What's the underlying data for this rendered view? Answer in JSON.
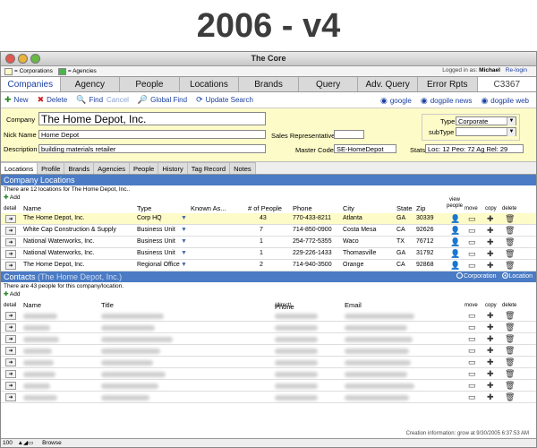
{
  "headline": "2006 - v4",
  "window": {
    "title": "The Core"
  },
  "legend": {
    "corporations": "= Corporations",
    "agencies": "= Agencies",
    "corp_color": "#fdfbc8",
    "agency_color": "#4cb34c"
  },
  "login": {
    "label": "Logged in as:",
    "user": "Michael",
    "relogin": "Re-login"
  },
  "tabs": [
    "Companies",
    "Agency",
    "People",
    "Locations",
    "Brands",
    "Query",
    "Adv. Query",
    "Error Rpts"
  ],
  "code": "C3367",
  "toolbar": {
    "new": "New",
    "delete": "Delete",
    "find": "Find",
    "cancel": "Cancel",
    "global_find": "Global Find",
    "update_search": "Update Search",
    "google": "google",
    "dogpile_news": "dogpile news",
    "dogpile_web": "dogpile web"
  },
  "form": {
    "company_label": "Company",
    "company_value": "The Home Depot, Inc.",
    "nick_label": "Nick Name",
    "nick_value": "Home Depot",
    "desc_label": "Description",
    "desc_value": "building materials retailer",
    "rep_label": "Sales Representative",
    "rep_value": "",
    "master_label": "Master Code",
    "master_value": "SE-HomeDepot",
    "type_label": "Type",
    "type_value": "Corporate",
    "subtype_label": "subType",
    "subtype_value": "",
    "stats_label": "Stats",
    "stats_value": "Loc: 12 Peo: 72 Ag Rel: 29"
  },
  "subtabs": [
    "Locations",
    "Profile",
    "Brands",
    "Agencies",
    "People",
    "History",
    "Tag Record",
    "Notes"
  ],
  "locations": {
    "header": "Company Locations",
    "count_text": "There are 12 locations for The Home Depot, Inc..",
    "add": "Add",
    "columns": {
      "detail": "detail",
      "name": "Name",
      "type": "Type",
      "known": "Known As...",
      "people": "# of People",
      "phone": "Phone",
      "city": "City",
      "state": "State",
      "zip": "Zip",
      "view": "view people",
      "move": "move",
      "copy": "copy",
      "delete": "delete"
    },
    "rows": [
      {
        "name": "The Home Depot, Inc.",
        "type": "Corp HQ",
        "people": "43",
        "phone": "770-433-8211",
        "city": "Atlanta",
        "state": "GA",
        "zip": "30339"
      },
      {
        "name": "White Cap Construction & Supply",
        "type": "Business Unit",
        "people": "7",
        "phone": "714-850-0900",
        "city": "Costa Mesa",
        "state": "CA",
        "zip": "92626"
      },
      {
        "name": "National Waterworks, Inc.",
        "type": "Business Unit",
        "people": "1",
        "phone": "254-772-5355",
        "city": "Waco",
        "state": "TX",
        "zip": "76712"
      },
      {
        "name": "National Waterworks, Inc.",
        "type": "Business Unit",
        "people": "1",
        "phone": "229-226-1433",
        "city": "Thomasville",
        "state": "GA",
        "zip": "31792"
      },
      {
        "name": "The Home Depot, Inc.",
        "type": "Regional Office",
        "people": "2",
        "phone": "714-940-3500",
        "city": "Orange",
        "state": "CA",
        "zip": "92868"
      }
    ]
  },
  "contacts": {
    "header": "Contacts",
    "sub": "(The Home Depot, Inc.)",
    "radio_corp": "Corporation",
    "radio_loc": "Location",
    "count_text": "There are 43 people for this company/location.",
    "add": "Add",
    "columns": {
      "detail": "detail",
      "name": "Name",
      "title": "Title",
      "phone": "Phone",
      "phone_sub": "(direct)",
      "email": "Email",
      "move": "move",
      "copy": "copy",
      "delete": "delete"
    }
  },
  "creation": "Creation information: grow at 9/30/2005 6:37:53 AM",
  "status": {
    "zoom": "100",
    "mode": "Browse"
  }
}
